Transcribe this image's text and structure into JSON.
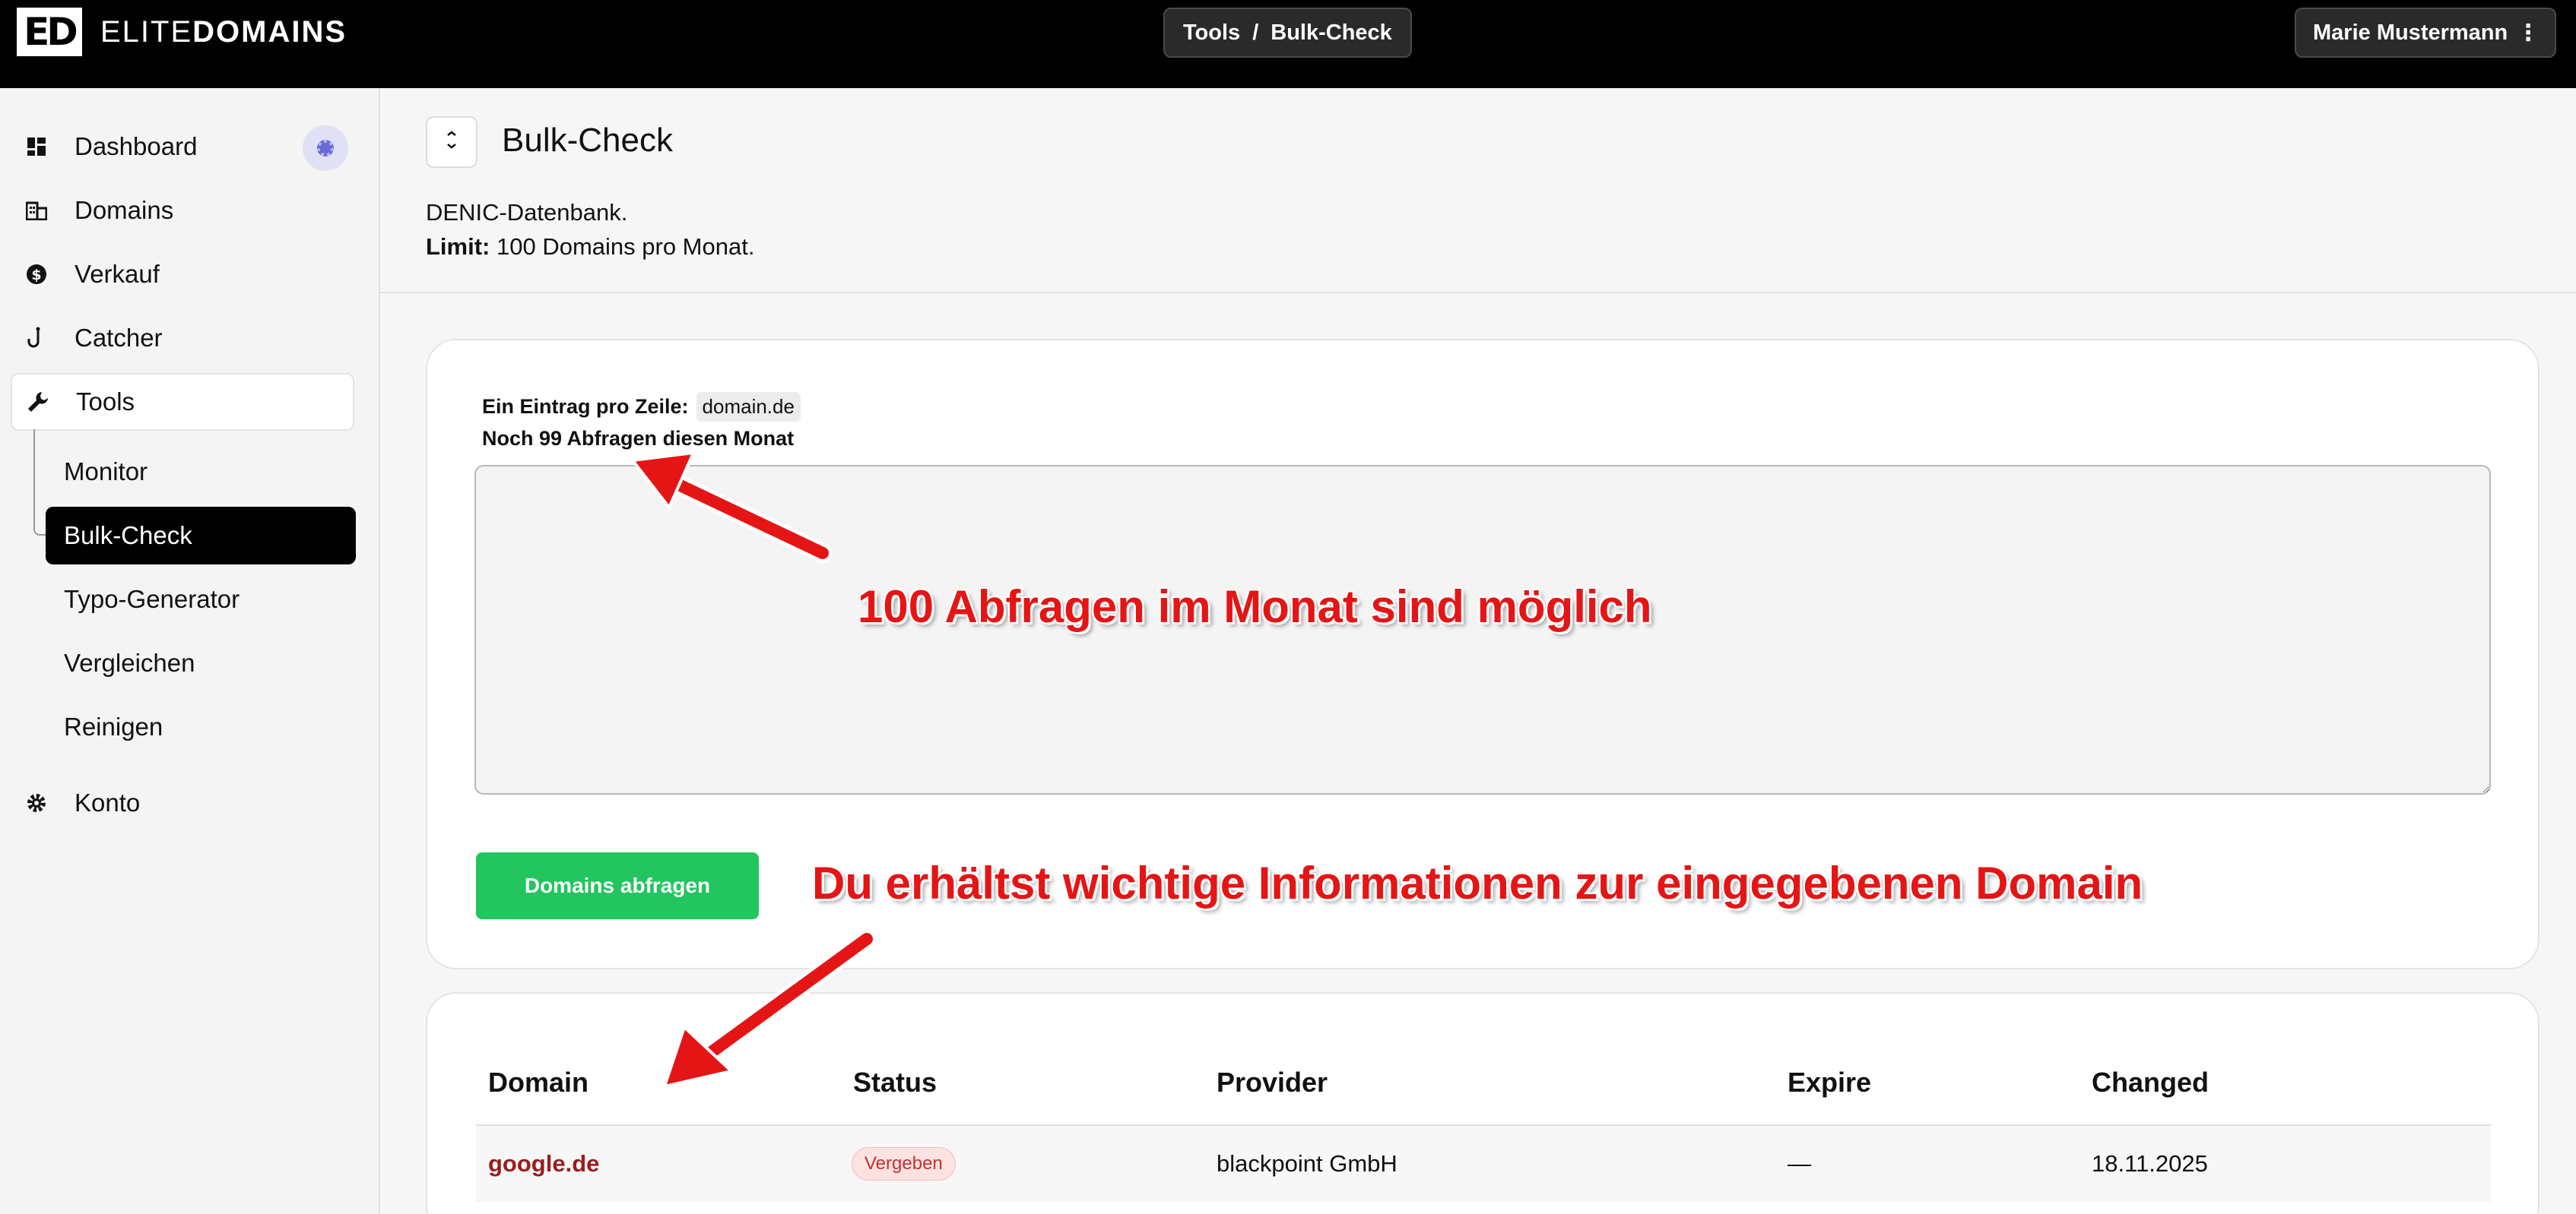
{
  "topbar": {
    "logo_mark": "ED",
    "logo_text_light": "ELITE",
    "logo_text_bold": "DOMAINS",
    "breadcrumb": {
      "section": "Tools",
      "separator": "/",
      "page": "Bulk-Check"
    },
    "user_name": "Marie Mustermann",
    "user_menu_glyph": "⋮"
  },
  "sidebar": {
    "items": [
      {
        "label": "Dashboard",
        "icon": "dashboard-icon"
      },
      {
        "label": "Domains",
        "icon": "building-icon"
      },
      {
        "label": "Verkauf",
        "icon": "dollar-icon"
      },
      {
        "label": "Catcher",
        "icon": "hook-icon"
      },
      {
        "label": "Tools",
        "icon": "wrench-icon"
      }
    ],
    "tools_sub": [
      {
        "label": "Monitor"
      },
      {
        "label": "Bulk-Check"
      },
      {
        "label": "Typo-Generator"
      },
      {
        "label": "Vergleichen"
      },
      {
        "label": "Reinigen"
      }
    ],
    "account": {
      "label": "Konto",
      "icon": "gear-icon"
    }
  },
  "header": {
    "collapse_glyph": "⌄",
    "title": "Bulk-Check",
    "source": "DENIC-Datenbank.",
    "limit_label": "Limit:",
    "limit_value": "100 Domains pro Monat."
  },
  "form": {
    "hint_label": "Ein Eintrag pro Zeile:",
    "hint_example": "domain.de",
    "remaining_prefix": "Noch",
    "remaining_bold": "99 Abfragen",
    "remaining_suffix": "diesen Monat",
    "textarea_value": "",
    "submit_label": "Domains abfragen"
  },
  "annotations": {
    "top": "100 Abfragen im Monat sind möglich",
    "bottom": "Du erhältst wichtige Informationen zur eingegebenen Domain",
    "color": "#e51515"
  },
  "table": {
    "headers": [
      "Domain",
      "Status",
      "Provider",
      "Expire",
      "Changed"
    ],
    "rows": [
      {
        "domain": "google.de",
        "status": "Vergeben",
        "provider": "blackpoint GmbH",
        "expire": "—",
        "changed": "18.11.2025"
      }
    ]
  },
  "colors": {
    "accent_green": "#22c55e",
    "domain_link": "#9b1c1c",
    "status_taken": "#c53030"
  }
}
